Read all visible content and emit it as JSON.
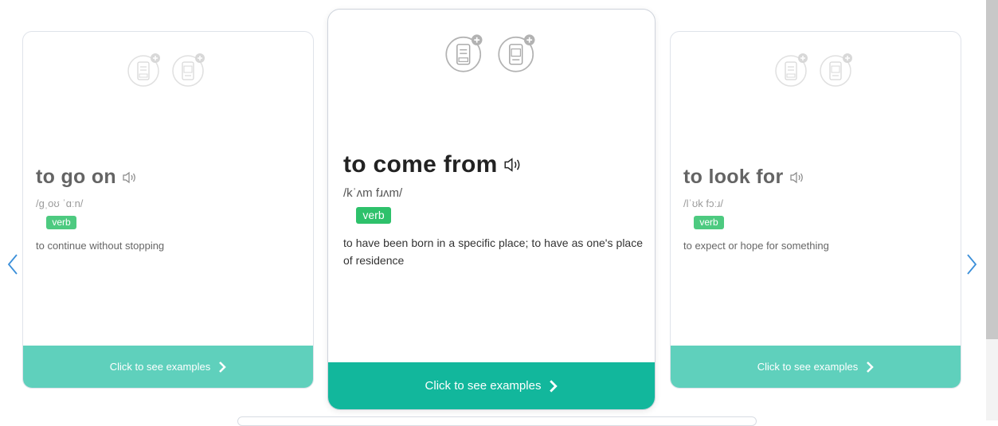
{
  "carousel": {
    "prev_icon": "chevron-left-icon",
    "next_icon": "chevron-right-icon",
    "accent_color": "#12b79c",
    "pos_color": "#2ec16b",
    "cards": [
      {
        "word": "to go on",
        "phonetic": "/ɡˌoʊ ˈɑːn/",
        "pos": "verb",
        "definition": "to continue without stopping",
        "footer": "Click to see examples"
      },
      {
        "word": "to come from",
        "phonetic": "/kˈʌm fɹʌm/",
        "pos": "verb",
        "definition": "to have been born in a specific place; to have as one's place of residence",
        "footer": "Click to see examples"
      },
      {
        "word": "to look for",
        "phonetic": "/lˈʊk fɔːɹ/",
        "pos": "verb",
        "definition": "to expect or hope for something",
        "footer": "Click to see examples"
      }
    ]
  }
}
